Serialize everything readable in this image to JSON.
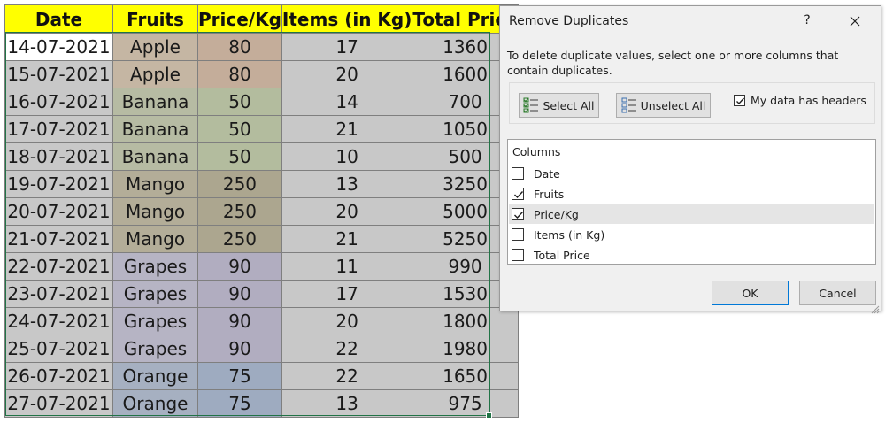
{
  "sheet": {
    "headers": [
      "Date",
      "Fruits",
      "Price/Kg",
      "Items (in Kg)",
      "Total Price"
    ],
    "rows": [
      {
        "date": "14-07-2021",
        "fruit": "Apple",
        "price": "80",
        "items": "17",
        "total": "1360"
      },
      {
        "date": "15-07-2021",
        "fruit": "Apple",
        "price": "80",
        "items": "20",
        "total": "1600"
      },
      {
        "date": "16-07-2021",
        "fruit": "Banana",
        "price": "50",
        "items": "14",
        "total": "700"
      },
      {
        "date": "17-07-2021",
        "fruit": "Banana",
        "price": "50",
        "items": "21",
        "total": "1050"
      },
      {
        "date": "18-07-2021",
        "fruit": "Banana",
        "price": "50",
        "items": "10",
        "total": "500"
      },
      {
        "date": "19-07-2021",
        "fruit": "Mango",
        "price": "250",
        "items": "13",
        "total": "3250"
      },
      {
        "date": "20-07-2021",
        "fruit": "Mango",
        "price": "250",
        "items": "20",
        "total": "5000"
      },
      {
        "date": "21-07-2021",
        "fruit": "Mango",
        "price": "250",
        "items": "21",
        "total": "5250"
      },
      {
        "date": "22-07-2021",
        "fruit": "Grapes",
        "price": "90",
        "items": "11",
        "total": "990"
      },
      {
        "date": "23-07-2021",
        "fruit": "Grapes",
        "price": "90",
        "items": "17",
        "total": "1530"
      },
      {
        "date": "24-07-2021",
        "fruit": "Grapes",
        "price": "90",
        "items": "20",
        "total": "1800"
      },
      {
        "date": "25-07-2021",
        "fruit": "Grapes",
        "price": "90",
        "items": "22",
        "total": "1980"
      },
      {
        "date": "26-07-2021",
        "fruit": "Orange",
        "price": "75",
        "items": "22",
        "total": "1650"
      },
      {
        "date": "27-07-2021",
        "fruit": "Orange",
        "price": "75",
        "items": "13",
        "total": "975"
      }
    ],
    "fruit_colors": {
      "Apple": "#c5b6a3",
      "Banana": "#b6bba3",
      "Mango": "#b3ad98",
      "Grapes": "#b6b4c4",
      "Orange": "#a6b0c1"
    },
    "price_colors": {
      "Apple": "#c4ad9a",
      "Banana": "#b3bc9e",
      "Mango": "#aca68f",
      "Grapes": "#b1adc0",
      "Orange": "#9eabc0"
    },
    "header_color": "#ffff00",
    "selection_color": "#217346"
  },
  "dialog": {
    "title": "Remove Duplicates",
    "help_label": "?",
    "close_icon": "close-icon",
    "description": "To delete duplicate values, select one or more columns that contain duplicates.",
    "select_all_label": "Select All",
    "unselect_all_label": "Unselect All",
    "headers_label": "My data has headers",
    "headers_checked": true,
    "columns_header": "Columns",
    "columns": [
      {
        "label": "Date",
        "checked": false
      },
      {
        "label": "Fruits",
        "checked": true
      },
      {
        "label": "Price/Kg",
        "checked": true
      },
      {
        "label": "Items (in Kg)",
        "checked": false
      },
      {
        "label": "Total Price",
        "checked": false
      }
    ],
    "ok_label": "OK",
    "cancel_label": "Cancel"
  }
}
